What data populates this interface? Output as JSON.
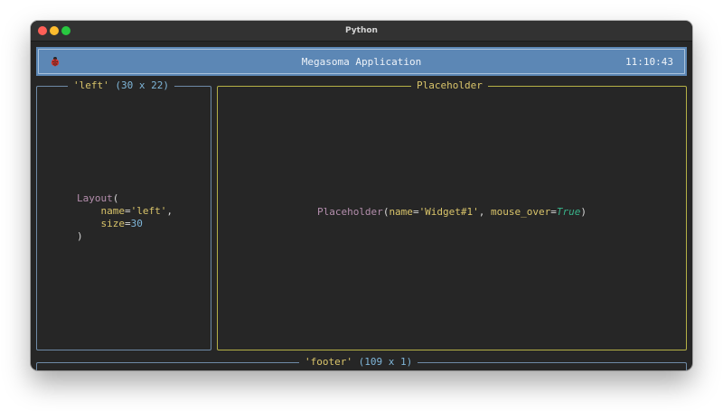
{
  "window": {
    "title": "Python"
  },
  "header": {
    "icon": "ladybug-icon",
    "title": "Megasoma Application",
    "clock": "11:10:43",
    "background_color": "#5c87b5"
  },
  "left_panel": {
    "title_name": "'left'",
    "title_size": "(30 x 22)",
    "code": {
      "class_name": "Layout",
      "open_paren": "(",
      "name_key": "name",
      "eq1": "=",
      "name_value": "'left'",
      "comma1": ",",
      "size_key": "size",
      "eq2": "=",
      "size_value": "30",
      "close_paren": ")"
    }
  },
  "main_panel": {
    "title": "Placeholder",
    "code": {
      "class_name": "Placeholder",
      "open_paren": "(",
      "name_key": "name",
      "eq1": "=",
      "name_value": "'Widget#1'",
      "comma": ", ",
      "mouse_key": "mouse_over",
      "eq2": "=",
      "mouse_value": "True",
      "close_paren": ")"
    }
  },
  "footer_panel": {
    "title_name": "'footer'",
    "title_size": "(109 x 1)"
  },
  "colors": {
    "terminal_bg": "#262626",
    "left_border": "#6e8aa6",
    "main_border": "#b5b046",
    "string_yellow": "#d9c46a",
    "keyword_purple": "#b48ead",
    "number_blue": "#7fb6d9",
    "true_green": "#39b38a"
  }
}
